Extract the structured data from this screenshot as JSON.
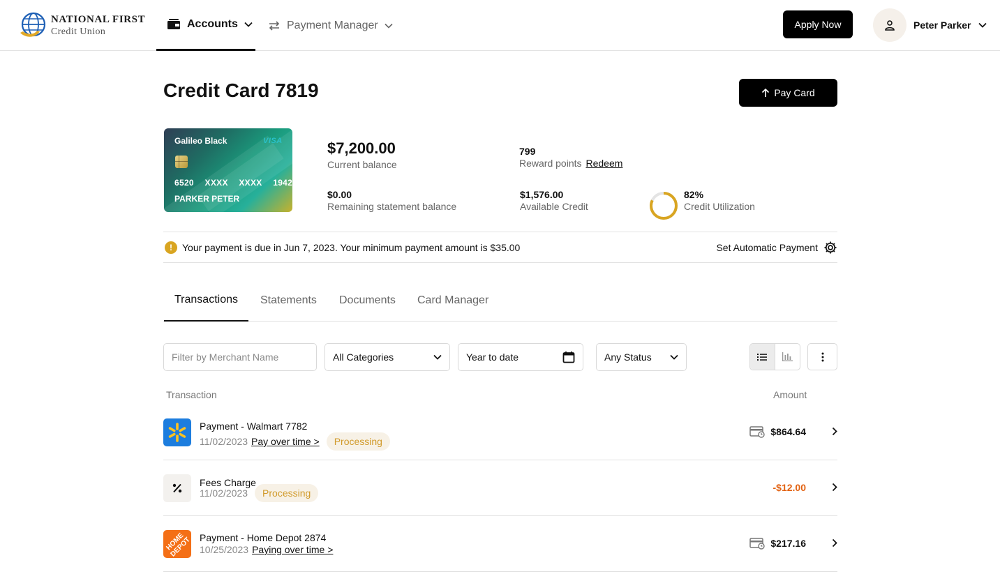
{
  "header": {
    "logo_line1": "NATIONAL FIRST",
    "logo_line2": "Credit Union",
    "nav": {
      "accounts": "Accounts",
      "payments": "Payment Manager"
    },
    "apply_label": "Apply Now",
    "user_name": "Peter Parker"
  },
  "page": {
    "title": "Credit Card 7819",
    "pay_label": "Pay Card"
  },
  "card": {
    "brand": "Galileo Black",
    "network": "VISA",
    "number_groups": "6520 XXXX XXXX 1942",
    "holder": "PARKER PETER"
  },
  "stats": {
    "current_balance": "$7,200.00",
    "current_balance_label": "Current balance",
    "reward_points": "799",
    "reward_points_label": "Reward points",
    "redeem_label": "Redeem",
    "statement_balance": "$0.00",
    "statement_balance_label": "Remaining statement balance",
    "available_credit": "$1,576.00",
    "available_credit_label": "Available Credit",
    "utilization": "82%",
    "utilization_value": 82,
    "utilization_label": "Credit Utilization"
  },
  "notice": {
    "message": "Your payment is due in Jun 7, 2023. Your minimum payment amount is $35.00",
    "auto_label": "Set Automatic Payment"
  },
  "tabs": [
    "Transactions",
    "Statements",
    "Documents",
    "Card Manager"
  ],
  "filters": {
    "merchant_placeholder": "Filter by Merchant Name",
    "category": "All Categories",
    "date_range": "Year to date",
    "status": "Any Status"
  },
  "table": {
    "col_transaction": "Transaction",
    "col_amount": "Amount",
    "rows": [
      {
        "title": "Payment - Walmart 7782",
        "date": "11/02/2023",
        "link": "Pay over time >",
        "status": "Processing",
        "amount": "$864.64"
      },
      {
        "title": "Fees Charge",
        "date": "11/02/2023",
        "link": "",
        "status": "Processing",
        "amount": "-$12.00"
      },
      {
        "title": "Payment - Home Depot 2874",
        "date": "10/25/2023",
        "link": "Paying over time >",
        "status": "",
        "amount": "$217.16"
      }
    ]
  },
  "colors": {
    "accent": "#000000",
    "gold": "#d9a521",
    "walmart_blue": "#1d7dde",
    "home_depot_orange": "#f46f16",
    "negative": "#e26212"
  },
  "icons": {
    "accounts": "wallet-icon",
    "payments": "swap-arrows-icon",
    "user": "person-icon",
    "warning": "exclamation-icon",
    "settings": "gear-icon",
    "calendar": "calendar-icon",
    "list_view": "list-icon",
    "chart_view": "bar-chart-icon",
    "more": "kebab-icon",
    "card_payment": "card-clock-icon",
    "fees": "percent-icon"
  }
}
